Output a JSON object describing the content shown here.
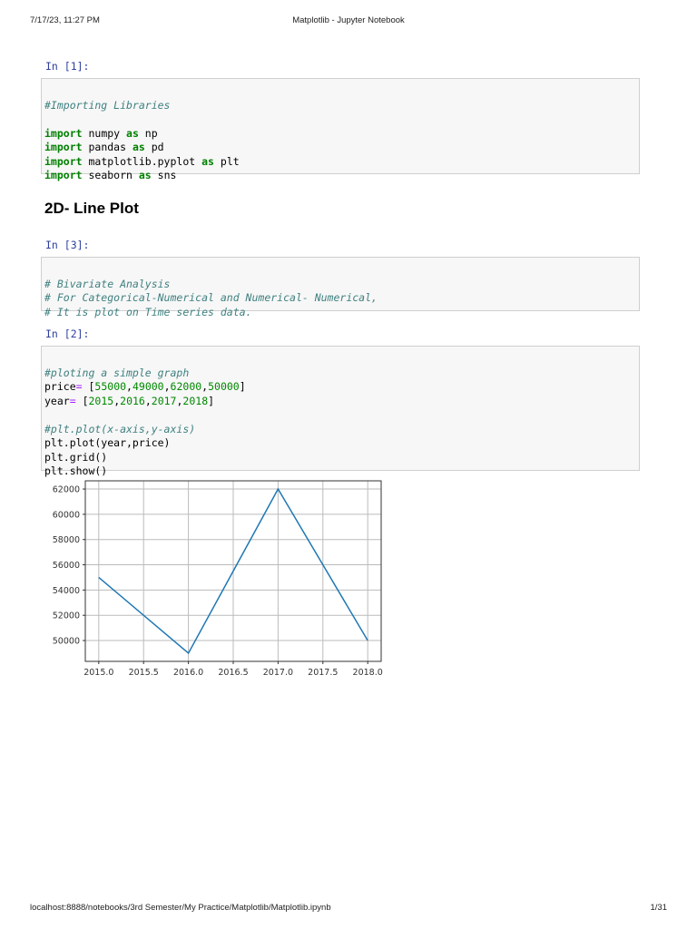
{
  "header": {
    "datetime": "7/17/23, 11:27 PM",
    "title": "Matplotlib - Jupyter Notebook"
  },
  "footer": {
    "url": "localhost:8888/notebooks/3rd Semester/My Practice/Matplotlib/Matplotlib.ipynb",
    "page": "1/31"
  },
  "cells": [
    {
      "prompt": "In [1]:",
      "comment": "#Importing Libraries",
      "imports": [
        [
          "import",
          "numpy",
          "as",
          "np"
        ],
        [
          "import",
          "pandas",
          "as",
          "pd"
        ],
        [
          "import",
          "matplotlib.pyplot",
          "as",
          "plt"
        ],
        [
          "import",
          "seaborn",
          "as",
          "sns"
        ]
      ]
    },
    {
      "heading": "2D- Line Plot"
    },
    {
      "prompt": "In [3]:",
      "lines": [
        "# Bivariate Analysis",
        "# For Categorical-Numerical and Numerical- Numerical,",
        "# It is plot on Time series data."
      ]
    },
    {
      "prompt": "In [2]:",
      "comment1": "#ploting a simple graph",
      "price_var": "price",
      "price_vals": [
        "55000",
        "49000",
        "62000",
        "50000"
      ],
      "year_var": "year",
      "year_vals": [
        "2015",
        "2016",
        "2017",
        "2018"
      ],
      "comment2": "#plt.plot(x-axis,y-axis)",
      "code": [
        "plt.plot(year,price)",
        "plt.grid()",
        "plt.show()"
      ]
    }
  ],
  "chart_data": {
    "type": "line",
    "x": [
      2015,
      2016,
      2017,
      2018
    ],
    "series": [
      {
        "name": "price",
        "values": [
          55000,
          49000,
          62000,
          50000
        ],
        "color": "#1f77b4"
      }
    ],
    "xlim": [
      2014.85,
      2018.15
    ],
    "ylim": [
      48350,
      62650
    ],
    "xticks": [
      "2015.0",
      "2015.5",
      "2016.0",
      "2016.5",
      "2017.0",
      "2017.5",
      "2018.0"
    ],
    "yticks": [
      "50000",
      "52000",
      "54000",
      "56000",
      "58000",
      "60000",
      "62000"
    ],
    "grid": true,
    "title": "",
    "xlabel": "",
    "ylabel": ""
  }
}
